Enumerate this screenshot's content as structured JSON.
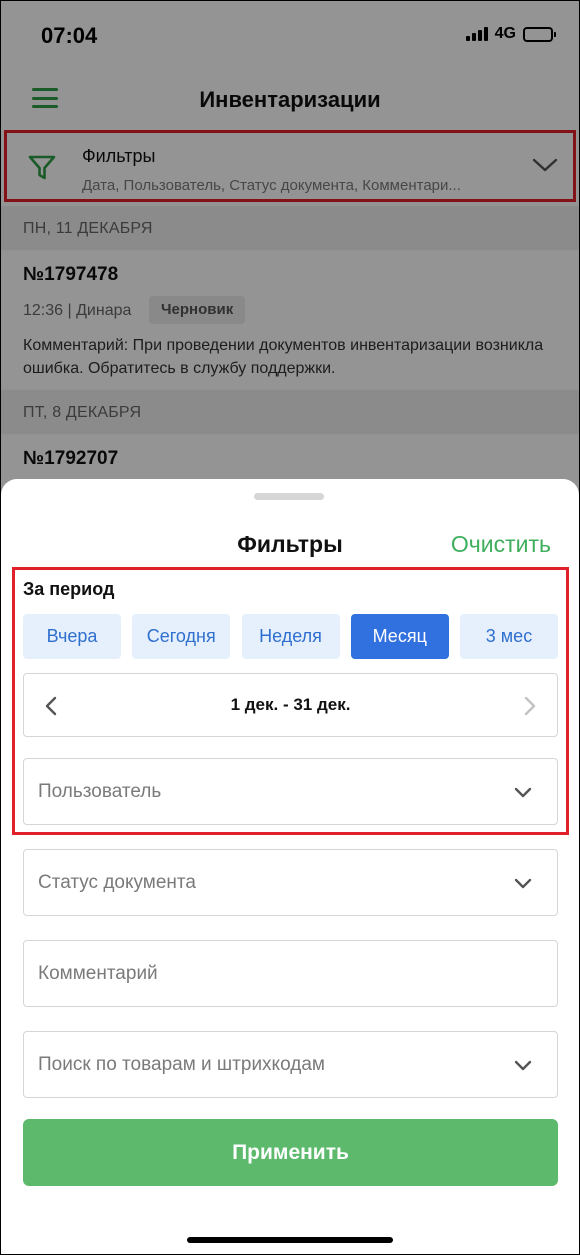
{
  "status_bar": {
    "time": "07:04",
    "network": "4G",
    "signal_bars": 4,
    "battery_level": 0.7
  },
  "header": {
    "title": "Инвентаризации",
    "menu_icon": "hamburger-icon",
    "accent_color": "#2e9e46"
  },
  "filter_bar": {
    "title": "Фильтры",
    "subtitle": "Дата, Пользователь, Статус документа, Комментари...",
    "icon": "filter-icon",
    "expand_icon": "chevron-down-icon"
  },
  "list": {
    "groups": [
      {
        "day": "ПН, 11 ДЕКАБРЯ",
        "docs": [
          {
            "number": "№1797478",
            "meta": "12:36 | Динара",
            "status": "Черновик",
            "comment": "Комментарий: При проведении документов инвентаризации возникла ошибка. Обратитесь в службу поддержки."
          }
        ]
      },
      {
        "day": "ПТ, 8 ДЕКАБРЯ",
        "docs": [
          {
            "number": "№1792707"
          }
        ]
      }
    ]
  },
  "sheet": {
    "title": "Фильтры",
    "clear_label": "Очистить",
    "period_label": "За период",
    "period_options": [
      "Вчера",
      "Сегодня",
      "Неделя",
      "Месяц",
      "3 мес"
    ],
    "selected_period": "Месяц",
    "date_range": "1 дек. - 31 дек.",
    "user_placeholder": "Пользователь",
    "status_placeholder": "Статус документа",
    "comment_placeholder": "Комментарий",
    "search_placeholder": "Поиск по товарам и штрихкодам",
    "apply_label": "Применить",
    "colors": {
      "chip_bg": "#e6f0fc",
      "chip_active": "#3170df",
      "apply": "#5dba6d",
      "clear": "#3fae5d",
      "highlight": "#e0202a"
    }
  }
}
